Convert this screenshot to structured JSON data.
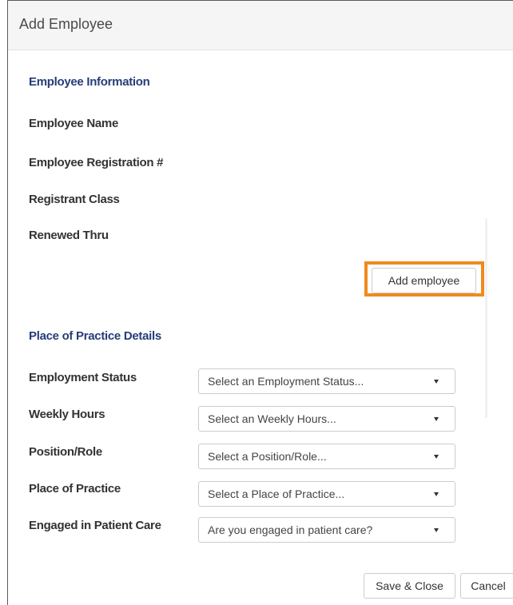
{
  "dialog": {
    "title": "Add Employee"
  },
  "employee_info": {
    "heading": "Employee Information",
    "fields": [
      "Employee Name",
      "Employee Registration #",
      "Registrant Class",
      "Renewed Thru"
    ],
    "add_button_label": "Add employee",
    "highlight_color": "#f08a1c"
  },
  "practice": {
    "heading": "Place of Practice Details",
    "rows": [
      {
        "label": "Employment Status",
        "placeholder": "Select an Employment Status..."
      },
      {
        "label": "Weekly Hours",
        "placeholder": "Select an Weekly Hours..."
      },
      {
        "label": "Position/Role",
        "placeholder": "Select a Position/Role..."
      },
      {
        "label": "Place of Practice",
        "placeholder": "Select a Place of Practice..."
      },
      {
        "label": "Engaged in Patient Care",
        "placeholder": "Are you engaged in patient care?"
      }
    ]
  },
  "footer": {
    "save_label": "Save & Close",
    "cancel_label": "Cancel"
  },
  "colors": {
    "heading": "#253d78",
    "label": "#333333",
    "accent": "#f08a1c"
  },
  "icons": {
    "dropdown": "caret-down-icon"
  }
}
